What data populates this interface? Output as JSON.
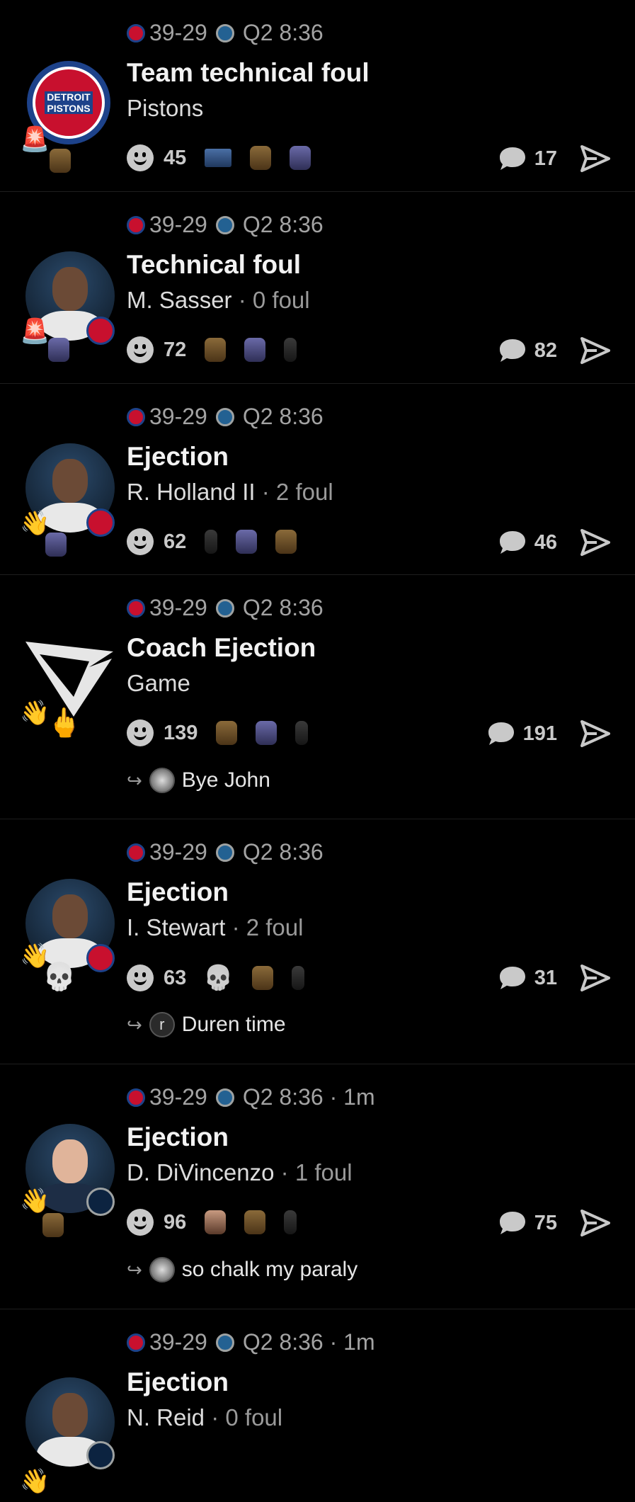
{
  "score": "39-29",
  "clock": "Q2 8:36",
  "clock_ago": "Q2 8:36 · 1m",
  "cards": [
    {
      "title": "Team technical foul",
      "name": "Pistons",
      "foul": "",
      "reactions": "45",
      "comments": "17",
      "reply": "",
      "reply_initial": ""
    },
    {
      "title": "Technical foul",
      "name": "M. Sasser",
      "foul": "· 0 foul",
      "reactions": "72",
      "comments": "82",
      "reply": "",
      "reply_initial": ""
    },
    {
      "title": "Ejection",
      "name": "R. Holland II",
      "foul": "· 2 foul",
      "reactions": "62",
      "comments": "46",
      "reply": "",
      "reply_initial": ""
    },
    {
      "title": "Coach Ejection",
      "name": "Game",
      "foul": "",
      "reactions": "139",
      "comments": "191",
      "reply": "Bye John",
      "reply_initial": ""
    },
    {
      "title": "Ejection",
      "name": "I. Stewart",
      "foul": "· 2 foul",
      "reactions": "63",
      "comments": "31",
      "reply": "Duren time",
      "reply_initial": "r"
    },
    {
      "title": "Ejection",
      "name": "D. DiVincenzo",
      "foul": "· 1 foul",
      "reactions": "96",
      "comments": "75",
      "reply": "so chalk my paraly",
      "reply_initial": ""
    },
    {
      "title": "Ejection",
      "name": "N. Reid",
      "foul": "· 0 foul",
      "reactions": "",
      "comments": "",
      "reply": "",
      "reply_initial": ""
    }
  ],
  "logo_text": [
    "DETROIT",
    "PISTONS"
  ],
  "colors": {
    "background": "#000000",
    "pistons_red": "#c8102e",
    "pistons_blue": "#1d428a",
    "wolves_navy": "#0c2340",
    "muted": "#a3a3a3"
  },
  "icons": [
    "pistons-logo-icon",
    "timberwolves-logo-icon",
    "smiley-icon",
    "comment-icon",
    "send-icon",
    "reply-arrow-icon",
    "siren-emoji",
    "wave-emoji",
    "middle-finger-emoji",
    "skull-emoji"
  ]
}
